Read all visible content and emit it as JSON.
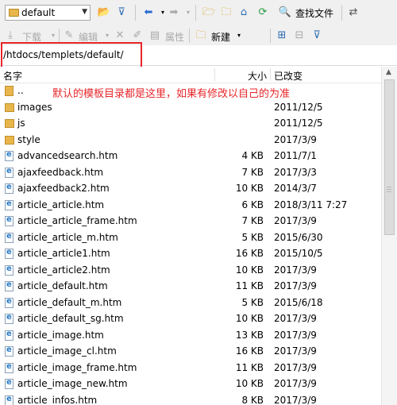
{
  "toolbar1": {
    "folder_combo": "default",
    "find_label": "查找文件"
  },
  "toolbar2": {
    "download_label": "下载",
    "edit_label": "编辑",
    "properties_label": "属性",
    "new_label": "新建"
  },
  "path": "/htdocs/templets/default/",
  "columns": {
    "name": "名字",
    "size": "大小",
    "modified": "已改变"
  },
  "annotation": "默认的模板目录都是这里，如果有修改以自己的为准",
  "files": [
    {
      "name": "..",
      "size": "",
      "date": "",
      "kind": "up"
    },
    {
      "name": "images",
      "size": "",
      "date": "2011/12/5",
      "kind": "folder"
    },
    {
      "name": "js",
      "size": "",
      "date": "2011/12/5",
      "kind": "folder"
    },
    {
      "name": "style",
      "size": "",
      "date": "2017/3/9",
      "kind": "folder"
    },
    {
      "name": "advancedsearch.htm",
      "size": "4 KB",
      "date": "2011/7/1",
      "kind": "file"
    },
    {
      "name": "ajaxfeedback.htm",
      "size": "7 KB",
      "date": "2017/3/3",
      "kind": "file"
    },
    {
      "name": "ajaxfeedback2.htm",
      "size": "10 KB",
      "date": "2014/3/7",
      "kind": "file"
    },
    {
      "name": "article_article.htm",
      "size": "6 KB",
      "date": "2018/3/11 7:27",
      "kind": "file"
    },
    {
      "name": "article_article_frame.htm",
      "size": "7 KB",
      "date": "2017/3/9",
      "kind": "file"
    },
    {
      "name": "article_article_m.htm",
      "size": "5 KB",
      "date": "2015/6/30",
      "kind": "file"
    },
    {
      "name": "article_article1.htm",
      "size": "16 KB",
      "date": "2015/10/5",
      "kind": "file"
    },
    {
      "name": "article_article2.htm",
      "size": "10 KB",
      "date": "2017/3/9",
      "kind": "file"
    },
    {
      "name": "article_default.htm",
      "size": "11 KB",
      "date": "2017/3/9",
      "kind": "file"
    },
    {
      "name": "article_default_m.htm",
      "size": "5 KB",
      "date": "2015/6/18",
      "kind": "file"
    },
    {
      "name": "article_default_sg.htm",
      "size": "10 KB",
      "date": "2017/3/9",
      "kind": "file"
    },
    {
      "name": "article_image.htm",
      "size": "13 KB",
      "date": "2017/3/9",
      "kind": "file"
    },
    {
      "name": "article_image_cl.htm",
      "size": "16 KB",
      "date": "2017/3/9",
      "kind": "file"
    },
    {
      "name": "article_image_frame.htm",
      "size": "11 KB",
      "date": "2017/3/9",
      "kind": "file"
    },
    {
      "name": "article_image_new.htm",
      "size": "10 KB",
      "date": "2017/3/9",
      "kind": "file"
    },
    {
      "name": "article_infos.htm",
      "size": "8 KB",
      "date": "2017/3/9",
      "kind": "file"
    }
  ]
}
